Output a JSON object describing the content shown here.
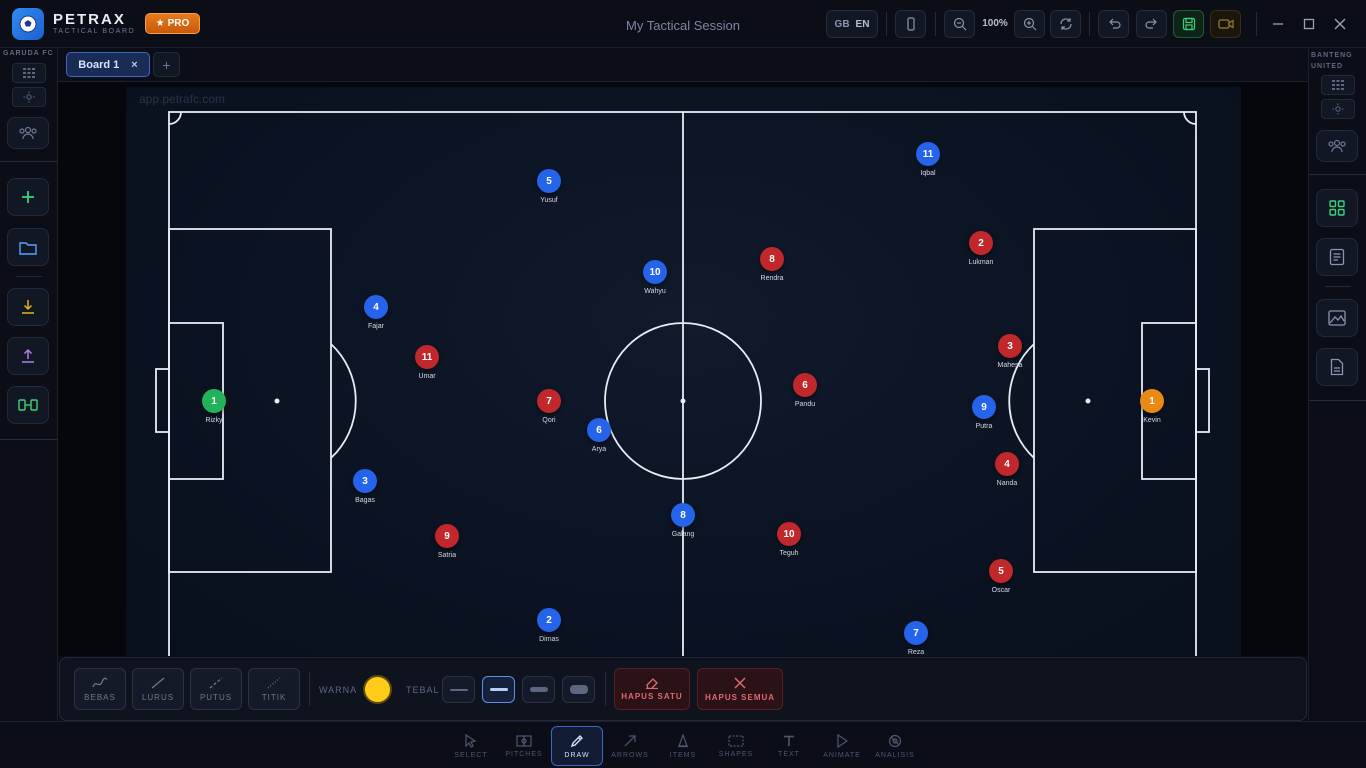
{
  "app": {
    "brand": "PETRAX",
    "brand_sub": "TACTICAL BOARD",
    "pro_label": "PRO",
    "session_title": "My Tactical Session"
  },
  "toolbar": {
    "lang_gb": "GB",
    "lang_en": "EN",
    "zoom": "100%"
  },
  "teams": {
    "home": "GARUDA FC",
    "away": "BANTENG UNITED"
  },
  "tabs": [
    {
      "label": "Board 1",
      "close": "×"
    }
  ],
  "tab_add": "+",
  "watermark": "app.petrafc.com",
  "players_blue": [
    {
      "number": "5",
      "name": "Yusuf"
    },
    {
      "number": "11",
      "name": "Iqbal"
    },
    {
      "number": "10",
      "name": "Wahyu"
    },
    {
      "number": "4",
      "name": "Fajar"
    },
    {
      "number": "6",
      "name": "Arya"
    },
    {
      "number": "9",
      "name": "Putra"
    },
    {
      "number": "3",
      "name": "Bagas"
    },
    {
      "number": "8",
      "name": "Galang"
    },
    {
      "number": "2",
      "name": "Dimas"
    },
    {
      "number": "7",
      "name": "Reza"
    }
  ],
  "players_red": [
    {
      "number": "8",
      "name": "Rendra"
    },
    {
      "number": "2",
      "name": "Lukman"
    },
    {
      "number": "11",
      "name": "Umar"
    },
    {
      "number": "3",
      "name": "Mahesa"
    },
    {
      "number": "7",
      "name": "Qori"
    },
    {
      "number": "6",
      "name": "Pandu"
    },
    {
      "number": "4",
      "name": "Nanda"
    },
    {
      "number": "9",
      "name": "Satria"
    },
    {
      "number": "10",
      "name": "Teguh"
    },
    {
      "number": "5",
      "name": "Oscar"
    }
  ],
  "goalkeepers": [
    {
      "number": "1",
      "name": "Rizky"
    },
    {
      "number": "1",
      "name": "Kevin"
    }
  ],
  "drawbar": {
    "tools": [
      "BEBAS",
      "LURUS",
      "PUTUS",
      "TITIK"
    ],
    "color_label": "WARNA",
    "color_value": "#ffcc1a",
    "thickness_label": "TEBAL",
    "delete_one": "HAPUS SATU",
    "delete_all": "HAPUS SEMUA"
  },
  "nav": [
    "SELECT",
    "PITCHES",
    "DRAW",
    "ARROWS",
    "ITEMS",
    "SHAPES",
    "TEXT",
    "ANIMATE",
    "ANALISIS"
  ],
  "colors": {
    "blue_team": "#2563eb",
    "red_team": "#c0282b",
    "accent": "#3a67c9"
  }
}
